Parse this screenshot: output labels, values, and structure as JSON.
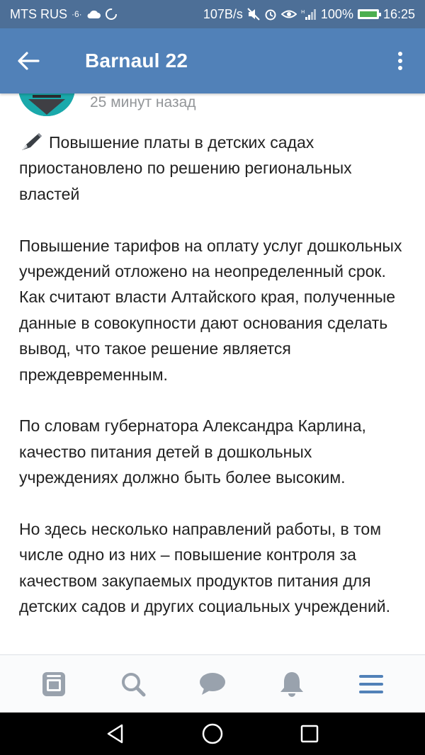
{
  "status_bar": {
    "carrier": "MTS RUS",
    "net_speed": "107B/s",
    "battery_percent": "100%",
    "battery_level": 1.0,
    "time": "16:25",
    "background_color": "#4d6f97"
  },
  "app_bar": {
    "title": "Barnaul 22",
    "background_color": "#5181b8"
  },
  "post": {
    "timestamp": "25 минут назад",
    "headline": "Повышение платы в детских садах приостановлено по решению региональных властей",
    "paragraphs": [
      "Повышение тарифов на оплату услуг дошкольных учреждений отложено на неопределенный срок. Как считают власти Алтайского края, полученные данные в совокупности дают основания сделать вывод, что такое решение является преждевременным.",
      "По словам губернатора Александра Карлина, качество питания детей в дошкольных учреждениях должно быть более высоким.",
      "Но здесь несколько направлений работы, в том числе одно из них – повышение контроля за качеством закупаемых продуктов питания для детских садов и других социальных учреждений."
    ]
  },
  "tab_bar": {
    "tabs": [
      "news-icon",
      "search-icon",
      "messages-icon",
      "notifications-icon",
      "menu-icon"
    ],
    "active_color": "#5181b8",
    "inactive_color": "#99a2ad"
  },
  "nav_bar": {
    "buttons": [
      "back-triangle-icon",
      "home-circle-icon",
      "recents-square-icon"
    ]
  }
}
